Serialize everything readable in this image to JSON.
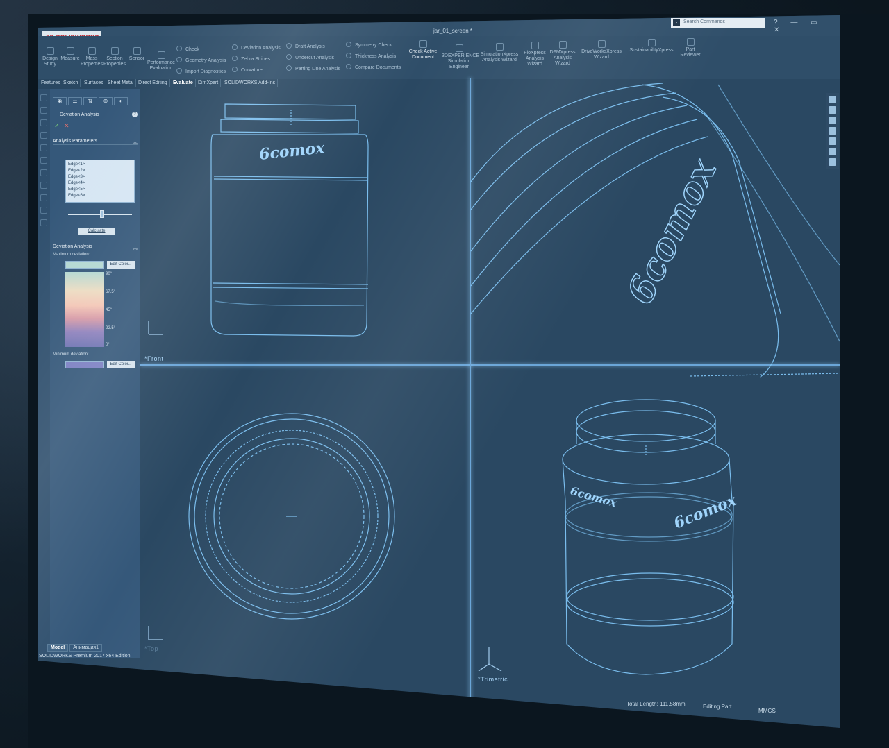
{
  "app": {
    "logo_text": "SOLIDWORKS",
    "logo_prefix": "3S",
    "document_title": "jar_01_screen *",
    "search_placeholder": "Search Commands"
  },
  "ribbon": {
    "large_items": [
      {
        "label1": "Design",
        "label2": "Study"
      },
      {
        "label1": "Measure",
        "label2": ""
      },
      {
        "label1": "Mass",
        "label2": "Properties"
      },
      {
        "label1": "Section",
        "label2": "Properties"
      },
      {
        "label1": "Sensor",
        "label2": ""
      },
      {
        "label1": "Performance",
        "label2": "Evaluation"
      }
    ],
    "col1": [
      "Check",
      "Geometry Analysis",
      "Import Diagnostics"
    ],
    "col2": [
      "Deviation Analysis",
      "Zebra Stripes",
      "Curvature"
    ],
    "col3": [
      "Draft Analysis",
      "Undercut Analysis",
      "Parting Line Analysis"
    ],
    "col4": [
      "Symmetry Check",
      "Thickness Analysis",
      "Compare Documents"
    ],
    "check_active": {
      "label1": "Check Active",
      "label2": "Document"
    },
    "right_items": [
      {
        "label1": "3DEXPERIENCE",
        "label2": "Simulation",
        "label3": "Engineer"
      },
      {
        "label1": "SimulationXpress",
        "label2": "Analysis Wizard",
        "label3": ""
      },
      {
        "label1": "FloXpress",
        "label2": "Analysis",
        "label3": "Wizard"
      },
      {
        "label1": "DFMXpress",
        "label2": "Analysis",
        "label3": "Wizard"
      },
      {
        "label1": "DriveWorksXpress",
        "label2": "Wizard",
        "label3": ""
      },
      {
        "label1": "SustainabilityXpress",
        "label2": "",
        "label3": ""
      },
      {
        "label1": "Part",
        "label2": "Reviewer",
        "label3": ""
      }
    ]
  },
  "tabs": [
    "Features",
    "Sketch",
    "Surfaces",
    "Sheet Metal",
    "Direct Editing",
    "Evaluate",
    "DimXpert",
    "SOLIDWORKS Add-Ins"
  ],
  "active_tab": "Evaluate",
  "property_manager": {
    "title": "Deviation Analysis",
    "help": "?",
    "ok": "✓",
    "cancel": "✕",
    "params_header": "Analysis Parameters",
    "edges": [
      "Edge<1>",
      "Edge<2>",
      "Edge<3>",
      "Edge<4>",
      "Edge<5>",
      "Edge<6>"
    ],
    "calculate_label": "Calculate",
    "deviation_header": "Deviation Analysis",
    "max_label": "Maximum deviation:",
    "min_label": "Minimum deviation:",
    "edit_color_label": "Edit Color...",
    "scale": [
      "90°",
      "67.5°",
      "45°",
      "22.5°",
      "0°"
    ],
    "max_color": "#b4d8d2",
    "min_color": "#7b7fc2"
  },
  "bottom_tabs": [
    "Model",
    "Анимация1"
  ],
  "edition": "SOLIDWORKS Premium 2017 x64 Edition",
  "viewports": {
    "front": "*Front",
    "top": "*Top",
    "trimetric": "*Trimetric"
  },
  "engraving": "6сотох",
  "status": {
    "total_length": "Total Length: 111.58mm",
    "mode": "Editing Part",
    "units": "MMGS"
  },
  "colors": {
    "wireframe": "#7fc4f5",
    "background": "#2a4862",
    "panel": "#35587a"
  }
}
